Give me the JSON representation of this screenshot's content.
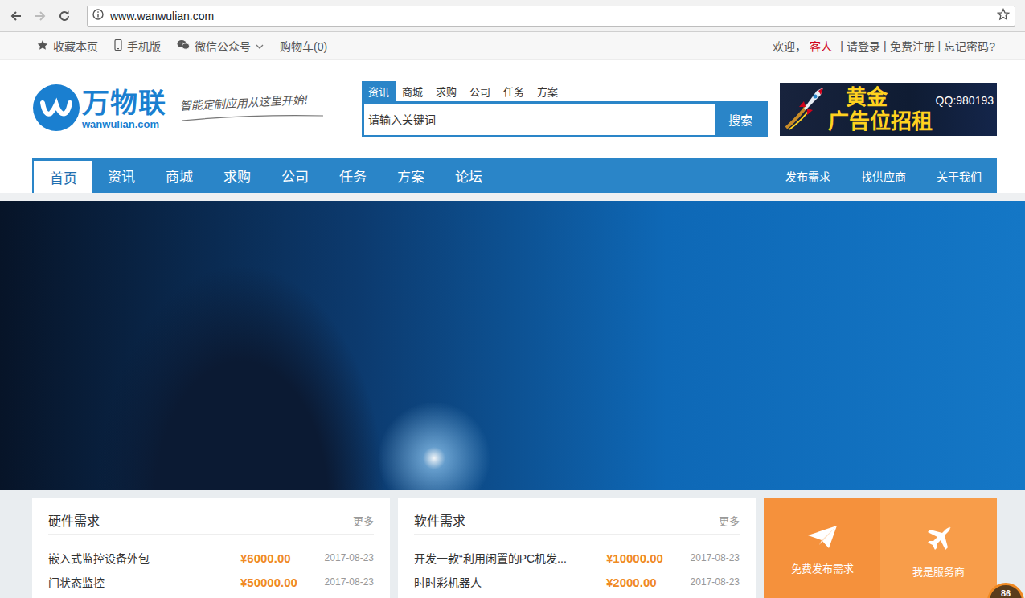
{
  "browser": {
    "url": "www.wanwulian.com"
  },
  "topbar": {
    "links": [
      "收藏本页",
      "手机版",
      "微信公众号",
      "购物车(0)"
    ],
    "welcome": "欢迎，",
    "user": "客人",
    "separator": "|",
    "account_links": [
      "请登录",
      "免费注册",
      "忘记密码?"
    ]
  },
  "logo": {
    "name": "万物联",
    "domain": "wanwulian.com",
    "slogan": "智能定制应用从这里开始!"
  },
  "search": {
    "tabs": [
      {
        "label": "资讯",
        "selected": true
      },
      {
        "label": "商城",
        "selected": false
      },
      {
        "label": "求购",
        "selected": false
      },
      {
        "label": "公司",
        "selected": false
      },
      {
        "label": "任务",
        "selected": false
      },
      {
        "label": "方案",
        "selected": false
      }
    ],
    "placeholder": "请输入关键词",
    "button": "搜索"
  },
  "ad": {
    "line1": "黄金",
    "line2": "广告位招租",
    "qq": "QQ:980193"
  },
  "nav": {
    "items": [
      {
        "label": "首页",
        "selected": true
      },
      {
        "label": "资讯",
        "selected": false
      },
      {
        "label": "商城",
        "selected": false
      },
      {
        "label": "求购",
        "selected": false
      },
      {
        "label": "公司",
        "selected": false
      },
      {
        "label": "任务",
        "selected": false
      },
      {
        "label": "方案",
        "selected": false
      },
      {
        "label": "论坛",
        "selected": false
      }
    ],
    "right": [
      "发布需求",
      "找供应商",
      "关于我们"
    ]
  },
  "panels": [
    {
      "title": "硬件需求",
      "more": "更多",
      "rows": [
        {
          "title": "嵌入式监控设备外包",
          "price": "¥6000.00",
          "date": "2017-08-23"
        },
        {
          "title": "门状态监控",
          "price": "¥50000.00",
          "date": "2017-08-23"
        }
      ]
    },
    {
      "title": "软件需求",
      "more": "更多",
      "rows": [
        {
          "title": "开发一款“利用闲置的PC机发...",
          "price": "¥10000.00",
          "date": "2017-08-23"
        },
        {
          "title": "时时彩机器人",
          "price": "¥2000.00",
          "date": "2017-08-23"
        }
      ]
    }
  ],
  "actions": [
    "免费发布需求",
    "我是服务商"
  ],
  "badge": "86"
}
